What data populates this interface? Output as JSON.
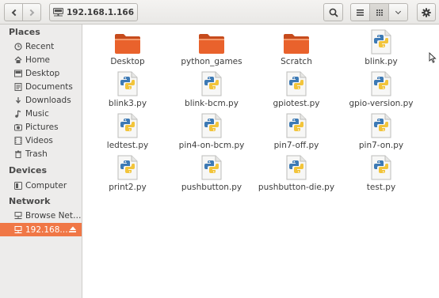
{
  "toolbar": {
    "location": "192.168.1.166"
  },
  "sidebar": {
    "places_title": "Places",
    "places": [
      {
        "label": "Recent",
        "icon": "clock-icon"
      },
      {
        "label": "Home",
        "icon": "home-icon"
      },
      {
        "label": "Desktop",
        "icon": "desktop-icon"
      },
      {
        "label": "Documents",
        "icon": "documents-icon"
      },
      {
        "label": "Downloads",
        "icon": "downloads-icon"
      },
      {
        "label": "Music",
        "icon": "music-icon"
      },
      {
        "label": "Pictures",
        "icon": "pictures-icon"
      },
      {
        "label": "Videos",
        "icon": "videos-icon"
      },
      {
        "label": "Trash",
        "icon": "trash-icon"
      }
    ],
    "devices_title": "Devices",
    "devices": [
      {
        "label": "Computer",
        "icon": "computer-icon"
      }
    ],
    "network_title": "Network",
    "network": [
      {
        "label": "Browse Net…",
        "icon": "network-icon"
      },
      {
        "label": "192.168.…",
        "icon": "network-share-icon",
        "active": true
      }
    ]
  },
  "files": [
    {
      "name": "Desktop",
      "type": "folder"
    },
    {
      "name": "python_games",
      "type": "folder"
    },
    {
      "name": "Scratch",
      "type": "folder"
    },
    {
      "name": "blink.py",
      "type": "python"
    },
    {
      "name": "blink3.py",
      "type": "python"
    },
    {
      "name": "blink-bcm.py",
      "type": "python"
    },
    {
      "name": "gpiotest.py",
      "type": "python"
    },
    {
      "name": "gpio-version.py",
      "type": "python"
    },
    {
      "name": "ledtest.py",
      "type": "python"
    },
    {
      "name": "pin4-on-bcm.py",
      "type": "python"
    },
    {
      "name": "pin7-off.py",
      "type": "python"
    },
    {
      "name": "pin7-on.py",
      "type": "python"
    },
    {
      "name": "print2.py",
      "type": "python"
    },
    {
      "name": "pushbutton.py",
      "type": "python"
    },
    {
      "name": "pushbutton-die.py",
      "type": "python"
    },
    {
      "name": "test.py",
      "type": "python"
    }
  ],
  "colors": {
    "accent": "#f07746",
    "folder": "#e9622c",
    "python_blue": "#3d7ab5",
    "python_yellow": "#f2c43a"
  }
}
